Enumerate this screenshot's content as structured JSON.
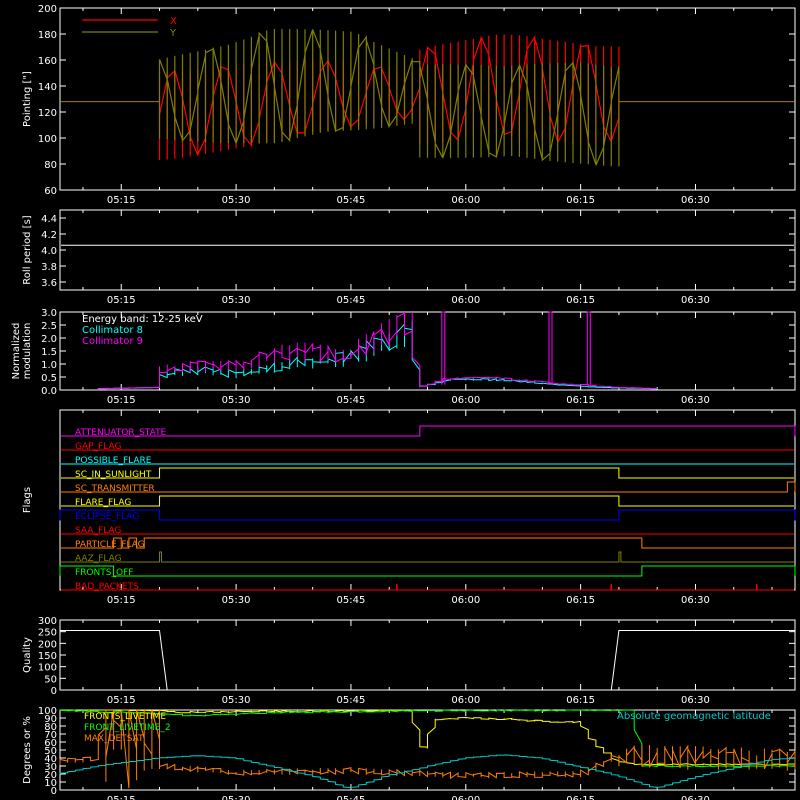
{
  "chart_data": [
    {
      "type": "line",
      "ylabel": "Pointing [\"]",
      "ylim": [
        60,
        200
      ],
      "yticks": [
        60,
        80,
        100,
        120,
        140,
        160,
        180,
        200
      ],
      "xticks": [
        "05:15",
        "05:30",
        "05:45",
        "06:00",
        "06:15",
        "06:30"
      ],
      "legend": [
        "X",
        "Y"
      ],
      "series": [
        {
          "name": "X",
          "color": "#ff0000",
          "baseline": 128,
          "start": "05:20",
          "end": "06:20",
          "envelope": [
            [
              "05:20",
              82,
              152
            ],
            [
              "05:30",
              92,
              158
            ],
            [
              "05:45",
              108,
              160
            ],
            [
              "05:54",
              116,
              150
            ],
            [
              "05:54",
              95,
              170
            ],
            [
              "06:05",
              100,
              180
            ],
            [
              "06:15",
              95,
              175
            ],
            [
              "06:20",
              98,
              172
            ]
          ]
        },
        {
          "name": "Y",
          "color": "#808000",
          "baseline": 128,
          "start": "05:20",
          "end": "06:20",
          "envelope": [
            [
              "05:20",
              98,
              160
            ],
            [
              "05:35",
              95,
              185
            ],
            [
              "05:45",
              104,
              182
            ],
            [
              "05:54",
              112,
              160
            ],
            [
              "05:54",
              85,
              160
            ],
            [
              "06:05",
              83,
              155
            ],
            [
              "06:15",
              80,
              160
            ],
            [
              "06:20",
              78,
              158
            ]
          ]
        }
      ]
    },
    {
      "type": "line",
      "ylabel": "Roll period [s]",
      "ylim": [
        3.5,
        4.5
      ],
      "yticks": [
        3.6,
        3.8,
        4.0,
        4.2,
        4.4
      ],
      "xticks": [
        "05:15",
        "05:30",
        "05:45",
        "06:00",
        "06:15",
        "06:30"
      ],
      "series": [
        {
          "name": "",
          "color": "#ffffff",
          "value": 4.06
        }
      ]
    },
    {
      "type": "line",
      "ylabel": "Normalized modulation",
      "ylim": [
        0,
        3.0
      ],
      "yticks": [
        0.0,
        0.5,
        1.0,
        1.5,
        2.0,
        2.5,
        3.0
      ],
      "xticks": [
        "05:15",
        "05:30",
        "05:45",
        "06:00",
        "06:15",
        "06:30"
      ],
      "annotation": "Energy band: 12-25 keV",
      "legend": [
        "Collimator 8",
        "Collimator 9"
      ],
      "series": [
        {
          "name": "Collimator 8",
          "color": "#00ffff",
          "points": [
            [
              "05:12",
              0.05
            ],
            [
              "05:20",
              0.1
            ],
            [
              "05:20",
              0.6
            ],
            [
              "05:25",
              0.8
            ],
            [
              "05:30",
              0.6
            ],
            [
              "05:37",
              1.0
            ],
            [
              "05:45",
              1.2
            ],
            [
              "05:53",
              2.3
            ],
            [
              "05:54",
              0.1
            ],
            [
              "05:58",
              0.4
            ],
            [
              "06:05",
              0.4
            ],
            [
              "06:12",
              0.2
            ],
            [
              "06:18",
              0.1
            ],
            [
              "06:20",
              0.08
            ],
            [
              "06:25",
              0.05
            ]
          ]
        },
        {
          "name": "Collimator 9",
          "color": "#ff00ff",
          "points": [
            [
              "05:12",
              0.05
            ],
            [
              "05:20",
              0.1
            ],
            [
              "05:20",
              0.8
            ],
            [
              "05:25",
              0.9
            ],
            [
              "05:30",
              0.9
            ],
            [
              "05:37",
              1.5
            ],
            [
              "05:45",
              1.4
            ],
            [
              "05:53",
              2.9
            ],
            [
              "05:54",
              0.1
            ],
            [
              "05:58",
              0.45
            ],
            [
              "06:05",
              0.45
            ],
            [
              "06:12",
              0.25
            ],
            [
              "06:18",
              0.15
            ],
            [
              "06:20",
              0.1
            ],
            [
              "06:25",
              0.05
            ]
          ],
          "spikes": [
            "05:57",
            "06:11",
            "06:16"
          ]
        }
      ]
    },
    {
      "type": "line",
      "ylabel": "Flags",
      "xticks": [
        "05:15",
        "05:30",
        "05:45",
        "06:00",
        "06:15",
        "06:30"
      ],
      "flags": [
        {
          "label": "ATTENUATOR_STATE",
          "color": "#ff00ff",
          "on": [
            [
              "05:54",
              "06:43"
            ]
          ]
        },
        {
          "label": "GAP_FLAG",
          "color": "#ff0000",
          "on": []
        },
        {
          "label": "POSSIBLE_FLARE",
          "color": "#00ffff",
          "on": []
        },
        {
          "label": "SC_IN_SUNLIGHT",
          "color": "#ffff00",
          "on": [
            [
              "05:20",
              "06:20"
            ]
          ]
        },
        {
          "label": "SC_TRANSMITTER",
          "color": "#ff8000",
          "on": [
            [
              "06:42",
              "06:43"
            ]
          ]
        },
        {
          "label": "FLARE_FLAG",
          "color": "#ffff00",
          "on": [
            [
              "05:20",
              "06:20"
            ]
          ]
        },
        {
          "label": "ECLIPSE_FLAG",
          "color": "#0000ff",
          "on": [
            [
              "05:07",
              "05:20"
            ],
            [
              "06:20",
              "06:43"
            ]
          ]
        },
        {
          "label": "SAA_FLAG",
          "color": "#ff0000",
          "on": []
        },
        {
          "label": "PARTICLE_FLAG",
          "color": "#ff8000",
          "on": [
            [
              "05:14",
              "05:15"
            ],
            [
              "05:16",
              "05:17"
            ],
            [
              "05:18",
              "06:23"
            ]
          ]
        },
        {
          "label": "AAZ_FLAG",
          "color": "#808000",
          "on": [
            [
              "05:20",
              "05:20"
            ],
            [
              "06:20",
              "06:20"
            ]
          ]
        },
        {
          "label": "FRONTS_OFF",
          "color": "#00ff00",
          "on": [
            [
              "05:07",
              "05:14"
            ],
            [
              "06:23",
              "06:43"
            ]
          ]
        },
        {
          "label": "BAD_PACKETS",
          "color": "#ff0000",
          "spikes": [
            "05:51",
            "06:19",
            "06:38"
          ]
        }
      ]
    },
    {
      "type": "line",
      "ylabel": "Quality",
      "ylim": [
        0,
        300
      ],
      "yticks": [
        0,
        50,
        100,
        150,
        200,
        250,
        300
      ],
      "xticks": [
        "05:15",
        "05:30",
        "05:45",
        "06:00",
        "06:15",
        "06:30"
      ],
      "series": [
        {
          "name": "",
          "color": "#ffffff",
          "points": [
            [
              "05:07",
              255
            ],
            [
              "05:20",
              255
            ],
            [
              "05:21",
              0
            ],
            [
              "06:19",
              0
            ],
            [
              "06:20",
              255
            ],
            [
              "06:43",
              255
            ]
          ]
        }
      ]
    },
    {
      "type": "line",
      "ylabel": "Degrees or %",
      "ylim": [
        0,
        100
      ],
      "yticks": [
        0,
        10,
        20,
        30,
        40,
        50,
        60,
        70,
        80,
        90,
        100
      ],
      "xticks": [
        "05:15",
        "05:30",
        "05:45",
        "06:00",
        "06:15",
        "06:30"
      ],
      "legend": [
        "FRONTS_LIVETIME",
        "FRONT_LIVETIME_2",
        "MAX_DETSAT"
      ],
      "annotation": "Absolute geomagnetic latitude",
      "series": [
        {
          "name": "FRONTS_LIVETIME",
          "color": "#ffff00",
          "points": [
            [
              "05:07",
              100
            ],
            [
              "05:20",
              100
            ],
            [
              "05:22",
              97
            ],
            [
              "05:30",
              98
            ],
            [
              "05:45",
              99
            ],
            [
              "05:53",
              100
            ],
            [
              "05:54",
              55
            ],
            [
              "05:55",
              52
            ],
            [
              "05:56",
              88
            ],
            [
              "06:00",
              90
            ],
            [
              "06:05",
              89
            ],
            [
              "06:10",
              86
            ],
            [
              "06:15",
              85
            ],
            [
              "06:17",
              56
            ],
            [
              "06:20",
              35
            ],
            [
              "06:23",
              32
            ],
            [
              "06:43",
              32
            ]
          ]
        },
        {
          "name": "FRONT_LIVETIME_2",
          "color": "#00ff00",
          "points": [
            [
              "05:07",
              100
            ],
            [
              "05:20",
              95
            ],
            [
              "05:25",
              93
            ],
            [
              "05:35",
              97
            ],
            [
              "05:45",
              98
            ],
            [
              "05:53",
              99
            ],
            [
              "06:20",
              100
            ],
            [
              "06:22",
              100
            ],
            [
              "06:23",
              30
            ],
            [
              "06:43",
              30
            ]
          ]
        },
        {
          "name": "MAX_DETSAT",
          "color": "#ff8000",
          "points": [
            [
              "05:07",
              35
            ],
            [
              "05:12",
              40
            ],
            [
              "05:13",
              100
            ],
            [
              "05:20",
              30
            ],
            [
              "05:30",
              22
            ],
            [
              "05:45",
              24
            ],
            [
              "06:00",
              18
            ],
            [
              "06:15",
              20
            ],
            [
              "06:20",
              42
            ],
            [
              "06:30",
              40
            ],
            [
              "06:43",
              38
            ]
          ]
        },
        {
          "name": "Absolute geomagnetic latitude",
          "color": "#00cccc",
          "points": [
            [
              "05:07",
              20
            ],
            [
              "05:12",
              30
            ],
            [
              "05:20",
              40
            ],
            [
              "05:25",
              43
            ],
            [
              "05:30",
              40
            ],
            [
              "05:40",
              18
            ],
            [
              "05:45",
              2
            ],
            [
              "05:50",
              18
            ],
            [
              "06:00",
              40
            ],
            [
              "06:05",
              44
            ],
            [
              "06:10",
              40
            ],
            [
              "06:20",
              18
            ],
            [
              "06:25",
              2
            ],
            [
              "06:30",
              16
            ],
            [
              "06:40",
              38
            ],
            [
              "06:43",
              40
            ]
          ]
        }
      ]
    }
  ]
}
